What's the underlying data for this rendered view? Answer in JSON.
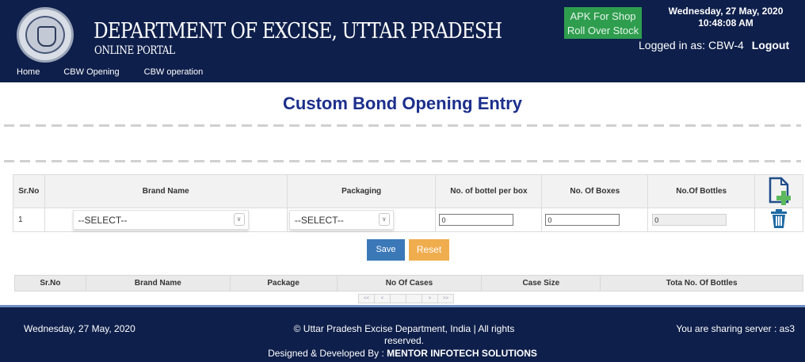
{
  "header": {
    "title": "DEPARTMENT OF EXCISE, UTTAR PRADESH",
    "subtitle": "ONLINE PORTAL",
    "apk_button": {
      "line1": "APK For Shop",
      "line2": "Roll Over Stock"
    },
    "date": "Wednesday, 27 May, 2020",
    "time": "10:48:08 AM",
    "logged_in_label": "Logged in as: CBW-4",
    "logout_label": "Logout",
    "logo_icon": "up-govt-emblem-icon"
  },
  "nav": {
    "items": [
      {
        "label": "Home"
      },
      {
        "label": "CBW Opening"
      },
      {
        "label": "CBW operation"
      }
    ]
  },
  "page": {
    "title": "Custom Bond Opening Entry"
  },
  "entry_table": {
    "headers": [
      "Sr.No",
      "Brand Name",
      "Packaging",
      "No. of bottel per box",
      "No. Of Boxes",
      "No.Of Bottles"
    ],
    "add_icon": "add-file-icon",
    "rows": [
      {
        "sr_no": "1",
        "brand_select": "--SELECT--",
        "packaging_select": "--SELECT--",
        "bottles_per_box": "0",
        "boxes": "0",
        "bottles": "0",
        "delete_icon": "trash-icon"
      }
    ]
  },
  "actions": {
    "save_label": "Save",
    "reset_label": "Reset"
  },
  "list_table": {
    "headers": [
      "Sr.No",
      "Brand Name",
      "Package",
      "No Of Cases",
      "Case Size",
      "Tota No. Of Bottles"
    ],
    "pager": [
      "<<",
      "<",
      "",
      "",
      ">",
      ">>"
    ]
  },
  "footer": {
    "date": "Wednesday, 27 May, 2020",
    "copyright": "© Uttar Pradesh Excise Department, India | All rights reserved.",
    "server": "You are sharing server : as3",
    "credit_prefix": "Designed & Developed By : ",
    "credit_company": "MENTOR INFOTECH SOLUTIONS"
  },
  "colors": {
    "header_bg": "#0e1f4b",
    "title_blue": "#1c2f8c",
    "apk_green": "#2e9e4e",
    "save_blue": "#3a78b8",
    "reset_orange": "#f0ad4e",
    "add_icon_green": "#5cb85c"
  }
}
